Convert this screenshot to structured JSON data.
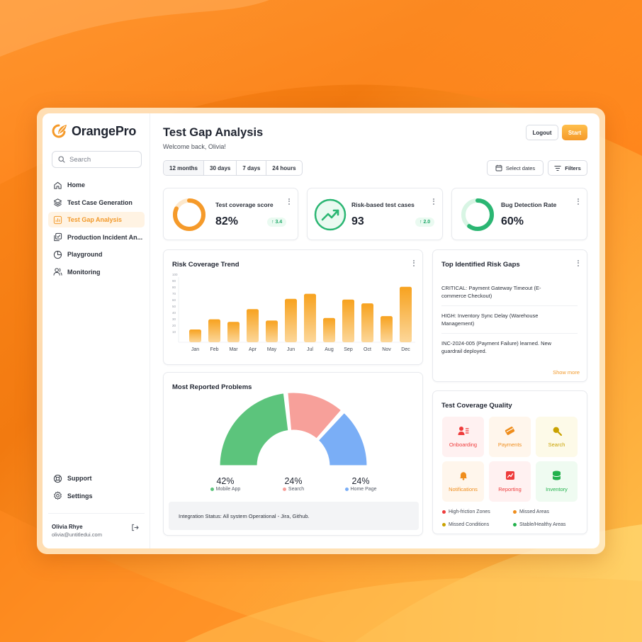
{
  "app": {
    "brand": "OrangePro"
  },
  "sidebar": {
    "search_placeholder": "Search",
    "items": [
      {
        "label": "Home",
        "icon": "home-icon"
      },
      {
        "label": "Test Case Generation",
        "icon": "layers-icon"
      },
      {
        "label": "Test Gap Analysis",
        "icon": "bar-chart-icon",
        "active": true
      },
      {
        "label": "Production Incident An...",
        "icon": "copy-check-icon"
      },
      {
        "label": "Playground",
        "icon": "pie-icon"
      },
      {
        "label": "Monitoring",
        "icon": "users-icon"
      }
    ],
    "bottom_items": [
      {
        "label": "Support",
        "icon": "life-buoy-icon"
      },
      {
        "label": "Settings",
        "icon": "gear-icon"
      }
    ],
    "user": {
      "name": "Olivia Rhye",
      "email": "olivia@untitledui.com"
    }
  },
  "header": {
    "title": "Test Gap Analysis",
    "subtitle": "Welcome back, Olivia!",
    "logout_label": "Logout",
    "start_label": "Start"
  },
  "filters": {
    "ranges": [
      "12 months",
      "30 days",
      "7 days",
      "24 hours"
    ],
    "active_range": "12 months",
    "dates_label": "Select dates",
    "filters_label": "Filters"
  },
  "stats": [
    {
      "label": "Test coverage score",
      "value": "82%",
      "delta": "3.4",
      "icon": "ring-progress-icon"
    },
    {
      "label": "Risk-based test cases",
      "value": "93",
      "delta": "2.0",
      "icon": "trending-up-icon"
    },
    {
      "label": "Bug Detection Rate",
      "value": "60%",
      "icon": "ring-progress-icon"
    }
  ],
  "stat_progress": {
    "coverage": 0.82,
    "bug_detection": 0.6
  },
  "colors": {
    "accent": "#f59a2a",
    "bar_top": "#f7a21f",
    "bar_bottom": "#fcd79a",
    "green": "#2bb673",
    "mobile": "#5cc47c",
    "search": "#f7a09a",
    "home": "#7aaef6"
  },
  "chart_data": {
    "type": "bar",
    "title": "Risk Coverage Trend",
    "categories": [
      "Jan",
      "Feb",
      "Mar",
      "Apr",
      "May",
      "Jun",
      "Jul",
      "Aug",
      "Sep",
      "Oct",
      "Nov",
      "Dec"
    ],
    "values": [
      20,
      36,
      32,
      52,
      34,
      68,
      76,
      38,
      67,
      61,
      41,
      87
    ],
    "y_ticks": [
      "100",
      "90",
      "80",
      "70",
      "60",
      "50",
      "40",
      "30",
      "20",
      "10"
    ],
    "ylim": [
      0,
      100
    ]
  },
  "risk_gaps": {
    "title": "Top Identified Risk Gaps",
    "items": [
      "CRITICAL: Payment Gateway Timeout (E-commerce Checkout)",
      "HIGH: Inventory Sync Delay (Warehouse Management)",
      "INC-2024-005 (Payment Failure) learned. New guardrail deployed."
    ],
    "show_more": "Show more"
  },
  "problems": {
    "title": "Most Reported Problems",
    "segments": [
      {
        "label": "Mobile App",
        "pct": "42%",
        "value": 42
      },
      {
        "label": "Search",
        "pct": "24%",
        "value": 24
      },
      {
        "label": "Home Page",
        "pct": "24%",
        "value": 24
      }
    ],
    "status": "Integration Status: All system Operational - Jira, Github."
  },
  "quality": {
    "title": "Test Coverage Quality",
    "tiles": [
      {
        "label": "Onboarding",
        "icon": "user-list-icon",
        "bg": "#fff1f1",
        "fg": "#ee3b3b"
      },
      {
        "label": "Payments",
        "icon": "card-icon",
        "bg": "#fff6ec",
        "fg": "#ef8d1c"
      },
      {
        "label": "Search",
        "icon": "magnifier-icon",
        "bg": "#fdfae8",
        "fg": "#c9a200"
      },
      {
        "label": "Notifications",
        "icon": "bell-icon",
        "bg": "#fff6ec",
        "fg": "#ef8d1c"
      },
      {
        "label": "Reporting",
        "icon": "report-icon",
        "bg": "#fff1f1",
        "fg": "#ee3b3b"
      },
      {
        "label": "Inventory",
        "icon": "database-icon",
        "bg": "#effbf1",
        "fg": "#22b14c"
      }
    ],
    "legend": [
      {
        "label": "High-friction Zones",
        "color": "#ee3b3b"
      },
      {
        "label": "Missed Areas",
        "color": "#ef8d1c"
      },
      {
        "label": "Missed Conditions",
        "color": "#c9a200"
      },
      {
        "label": "Stable/Healthy Areas",
        "color": "#22b14c"
      }
    ]
  }
}
